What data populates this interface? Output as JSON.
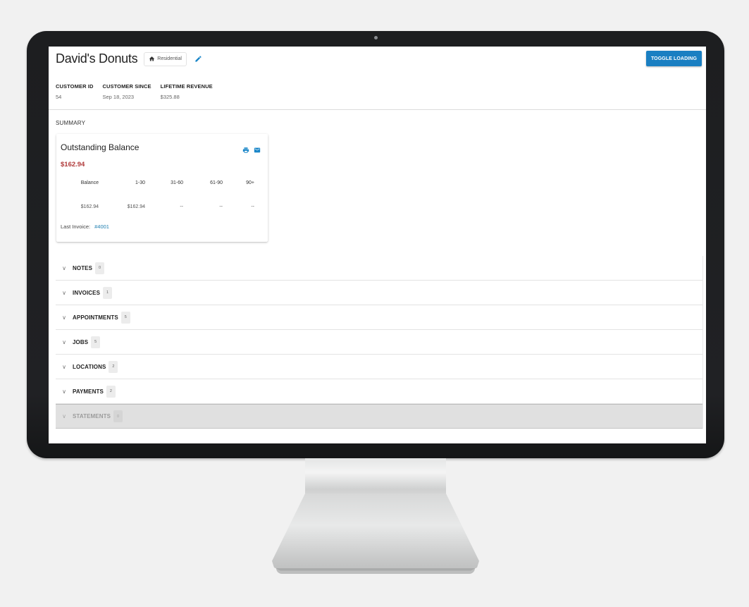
{
  "customer": {
    "name": "David's Donuts",
    "type_chip": {
      "label": "Residential",
      "icon": "home-icon"
    },
    "edit_icon": "pencil-icon",
    "meta": [
      {
        "label": "CUSTOMER ID",
        "value": "54"
      },
      {
        "label": "CUSTOMER SINCE",
        "value": "Sep 18, 2023"
      },
      {
        "label": "LIFETIME REVENUE",
        "value": "$325.88"
      }
    ]
  },
  "toolbar": {
    "toggle_loading_label": "TOGGLE LOADING"
  },
  "summary": {
    "section_label": "SUMMARY",
    "card": {
      "title": "Outstanding Balance",
      "amount": "$162.94",
      "icons": [
        "print-icon",
        "email-icon"
      ],
      "aging_headers": [
        "Balance",
        "1-30",
        "31-60",
        "61-90",
        "90+"
      ],
      "aging_values": [
        "$162.94",
        "$162.94",
        "--",
        "--",
        "--"
      ],
      "last_invoice_label": "Last Invoice:",
      "last_invoice_link": "#4001"
    }
  },
  "sections": [
    {
      "label": "NOTES",
      "count": "0",
      "disabled": false
    },
    {
      "label": "INVOICES",
      "count": "1",
      "disabled": false
    },
    {
      "label": "APPOINTMENTS",
      "count": "5",
      "disabled": false
    },
    {
      "label": "JOBS",
      "count": "5",
      "disabled": false
    },
    {
      "label": "LOCATIONS",
      "count": "2",
      "disabled": false
    },
    {
      "label": "PAYMENTS",
      "count": "2",
      "disabled": false
    },
    {
      "label": "STATEMENTS",
      "count": "0",
      "disabled": true
    }
  ],
  "colors": {
    "accent": "#1a7fc2",
    "balance_red": "#b03a3a",
    "link": "#1f7fb0"
  }
}
